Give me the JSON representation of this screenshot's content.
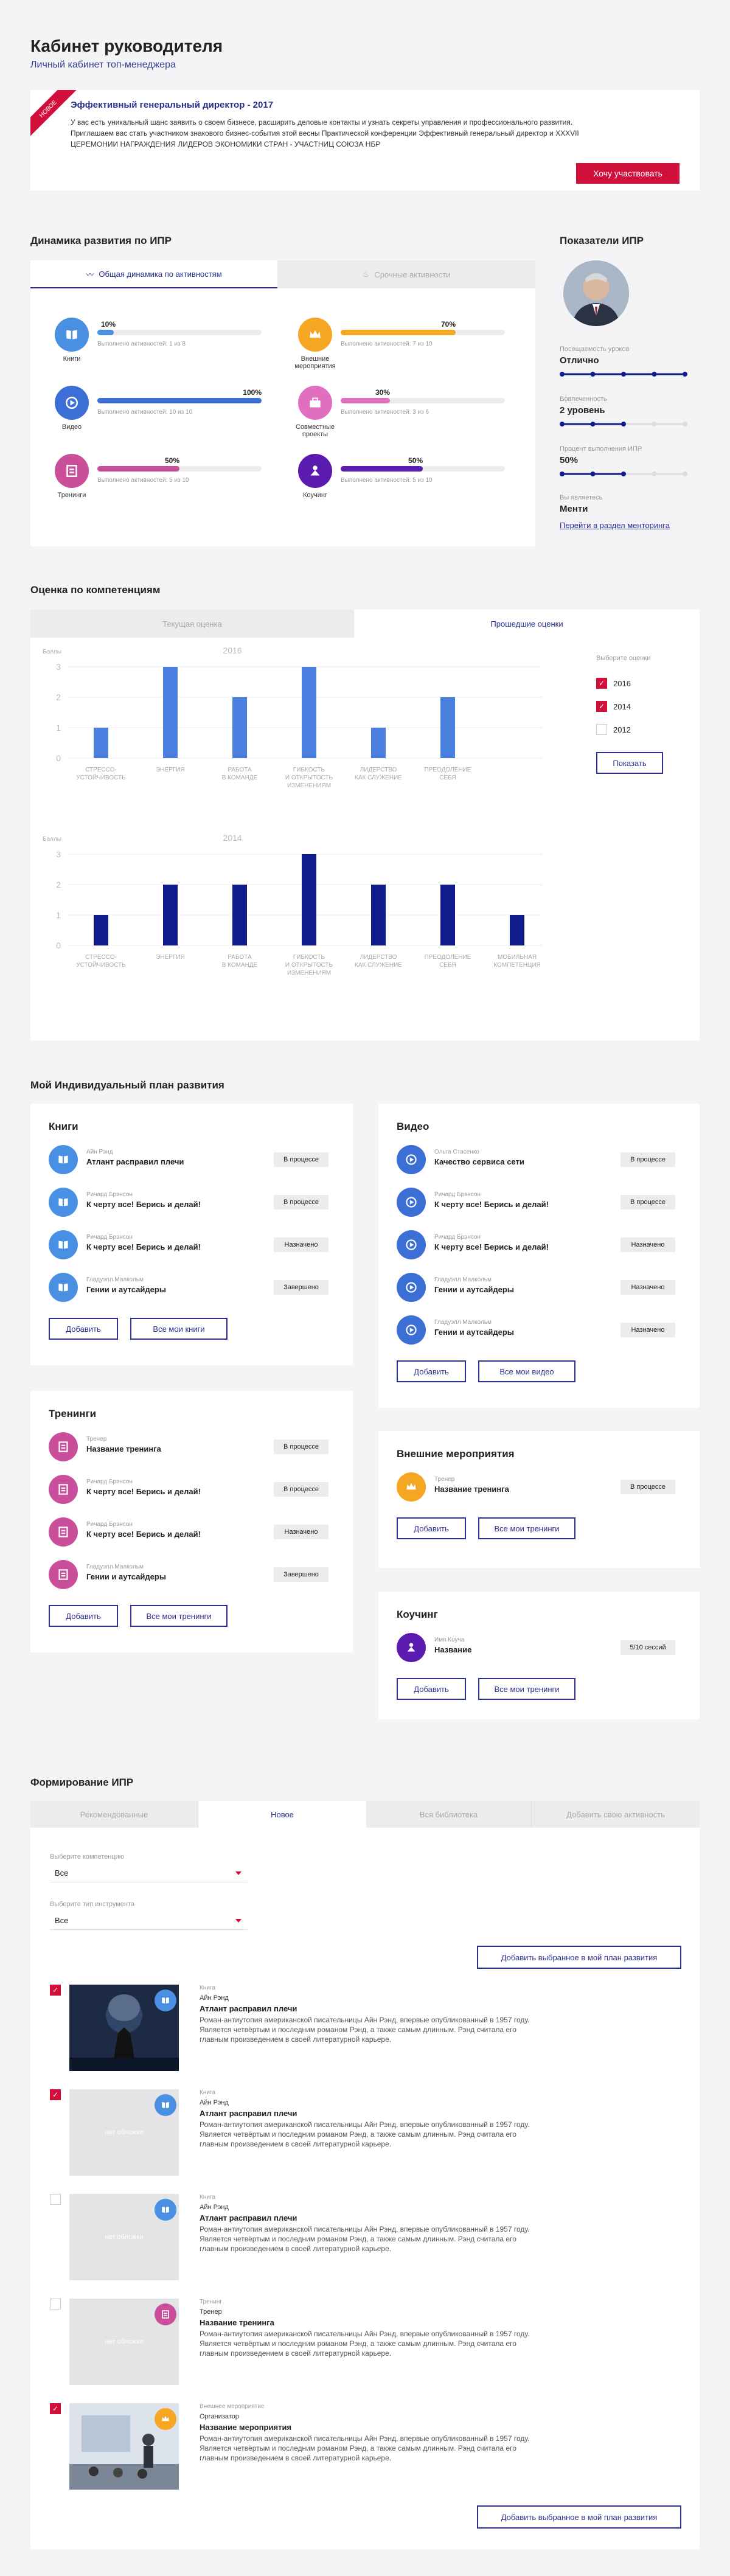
{
  "header": {
    "title": "Кабинет руководителя",
    "subtitle": "Личный кабинет топ-менеджера"
  },
  "promo": {
    "ribbon": "НОВОЕ",
    "title": "Эффективный генеральный директор - 2017",
    "text1": "У вас есть уникальный шанс заявить о своем бизнесе, расширить деловые контакты и узнать секреты управления и профессионального развития.",
    "text2": "Приглашаем вас стать участником знакового бизнес-события этой весны Практической конференции Эффективный генеральный директор и XXXVII",
    "text3": "ЦЕРЕМОНИИ НАГРАЖДЕНИЯ ЛИДЕРОВ ЭКОНОМИКИ СТРАН - УЧАСТНИЦ СОЮЗА НБР",
    "button": "Хочу участвовать"
  },
  "dynamics": {
    "title": "Динамика развития по ИПР",
    "tabs": [
      "Общая динамика по активностям",
      "Срочные активности"
    ],
    "items": [
      {
        "label": "Книги",
        "pct": "10%",
        "fill": 0.1,
        "note": "Выполнено активностей: 1 из 8",
        "color": "#4a90e2",
        "icon": "book-icon"
      },
      {
        "label": "Внешние мероприятия",
        "pct": "70%",
        "fill": 0.7,
        "note": "Выполнено активностей: 7 из 10",
        "color": "#f5a623",
        "icon": "crown-icon"
      },
      {
        "label": "Видео",
        "pct": "100%",
        "fill": 1.0,
        "note": "Выполнено активностей: 10 из 10",
        "color": "#3b6fd6",
        "icon": "play-icon"
      },
      {
        "label": "Совместные проекты",
        "pct": "30%",
        "fill": 0.3,
        "note": "Выполнено активностей: 3 из 6",
        "color": "#e06fc0",
        "icon": "briefcase-icon"
      },
      {
        "label": "Тренинги",
        "pct": "50%",
        "fill": 0.5,
        "note": "Выполнено активностей: 5 из 10",
        "color": "#c94f9a",
        "icon": "training-icon"
      },
      {
        "label": "Коучинг",
        "pct": "50%",
        "fill": 0.5,
        "note": "Выполнено активностей: 5 из 10",
        "color": "#5b1bb0",
        "icon": "coaching-icon"
      }
    ]
  },
  "ipr": {
    "title": "Показатели ИПР",
    "rows": [
      {
        "caption": "Посещаемость уроков",
        "value": "Отлично",
        "level": 1.0
      },
      {
        "caption": "Вовлеченность",
        "value": "2 уровень",
        "level": 0.5
      },
      {
        "caption": "Процент выполнения ИПР",
        "value": "50%",
        "level": 0.5
      }
    ],
    "mentor_caption": "Вы являетесь",
    "mentor_value": "Менти",
    "mentor_link": "Перейти в раздел менторинга"
  },
  "competence": {
    "title": "Оценка по компетенциям",
    "tabs": [
      "Текущая оценка",
      "Прошедшие оценки"
    ],
    "choose": "Выберите оценки",
    "years": [
      {
        "y": "2016",
        "on": true
      },
      {
        "y": "2014",
        "on": true
      },
      {
        "y": "2012",
        "on": false
      }
    ],
    "show": "Показать"
  },
  "chart_data": [
    {
      "type": "bar",
      "title": "2016",
      "ylabel": "Баллы",
      "ylim": [
        0,
        3
      ],
      "categories": [
        "СТРЕССОУСТОЙЧИВОСТЬ",
        "ЭНЕРГИЯ",
        "РАБОТА В КОМАНДЕ",
        "ГИБКОСТЬ И ОТКРЫТОСТЬ ИЗМЕНЕНИЯМ",
        "ЛИДЕРСТВО КАК СЛУЖЕНИЕ",
        "ПРЕОДОЛЕНИЕ СЕБЯ"
      ],
      "cat_lines": [
        [
          "СТРЕССО-",
          "УСТОЙЧИВОСТЬ"
        ],
        [
          "ЭНЕРГИЯ"
        ],
        [
          "РАБОТА",
          "В КОМАНДЕ"
        ],
        [
          "ГИБКОСТЬ",
          "И ОТКРЫТОСТЬ",
          "ИЗМЕНЕНИЯМ"
        ],
        [
          "ЛИДЕРСТВО",
          "КАК СЛУЖЕНИЕ"
        ],
        [
          "ПРЕОДОЛЕНИЕ",
          "СЕБЯ"
        ]
      ],
      "values": [
        1,
        3,
        2,
        3,
        1,
        2
      ],
      "color": "#4a7fe0"
    },
    {
      "type": "bar",
      "title": "2014",
      "ylabel": "Баллы",
      "ylim": [
        0,
        3
      ],
      "categories": [
        "СТРЕССОУСТОЙЧИВОСТЬ",
        "ЭНЕРГИЯ",
        "РАБОТА В КОМАНДЕ",
        "ГИБКОСТЬ И ОТКРЫТОСТЬ ИЗМЕНЕНИЯМ",
        "ЛИДЕРСТВО КАК СЛУЖЕНИЕ",
        "ПРЕОДОЛЕНИЕ СЕБЯ",
        "МОБИЛЬНАЯ КОМПЕТЕНЦИЯ"
      ],
      "cat_lines": [
        [
          "СТРЕССО-",
          "УСТОЙЧИВОСТЬ"
        ],
        [
          "ЭНЕРГИЯ"
        ],
        [
          "РАБОТА",
          "В КОМАНДЕ"
        ],
        [
          "ГИБКОСТЬ",
          "И ОТКРЫТОСТЬ",
          "ИЗМЕНЕНИЯМ"
        ],
        [
          "ЛИДЕРСТВО",
          "КАК СЛУЖЕНИЕ"
        ],
        [
          "ПРЕОДОЛЕНИЕ",
          "СЕБЯ"
        ],
        [
          "МОБИЛЬНАЯ",
          "КОМПЕТЕНЦИЯ"
        ]
      ],
      "values": [
        1,
        2,
        2,
        3,
        2,
        2,
        1
      ],
      "color": "#101c8c"
    }
  ],
  "plan": {
    "title": "Мой Индивидуальный план развития",
    "add": "Добавить",
    "books": {
      "title": "Книги",
      "all": "Все мои книги",
      "items": [
        {
          "author": "Айн Рэнд",
          "name": "Атлант расправил плечи",
          "status": "В процессе"
        },
        {
          "author": "Ричард Брэнсон",
          "name": "К черту все! Берись и делай!",
          "status": "В процессе"
        },
        {
          "author": "Ричард Брэнсон",
          "name": "К черту все! Берись и делай!",
          "status": "Назначено"
        },
        {
          "author": "Гладуэлл Малкольм",
          "name": "Гении и аутсайдеры",
          "status": "Завершено"
        }
      ]
    },
    "video": {
      "title": "Видео",
      "all": "Все мои видео",
      "items": [
        {
          "author": "Ольга Стасенко",
          "name": "Качество сервиса сети",
          "status": "В процессе"
        },
        {
          "author": "Ричард Брэнсон",
          "name": "К черту все! Берись и делай!",
          "status": "В процессе"
        },
        {
          "author": "Ричард Брэнсон",
          "name": "К черту все! Берись и делай!",
          "status": "Назначено"
        },
        {
          "author": "Гладуэлл Малкольм",
          "name": "Гении и аутсайдеры",
          "status": "Назначено"
        },
        {
          "author": "Гладуэлл Малкольм",
          "name": "Гении и аутсайдеры",
          "status": "Назначено"
        }
      ]
    },
    "trainings": {
      "title": "Тренинги",
      "all": "Все мои тренинги",
      "items": [
        {
          "author": "Тренер",
          "name": "Название тренинга",
          "status": "В процессе"
        },
        {
          "author": "Ричард Брэнсон",
          "name": "К черту все! Берись и делай!",
          "status": "В процессе"
        },
        {
          "author": "Ричард Брэнсон",
          "name": "К черту все! Берись и делай!",
          "status": "Назначено"
        },
        {
          "author": "Гладуэлл Малкольм",
          "name": "Гении и аутсайдеры",
          "status": "Завершено"
        }
      ]
    },
    "events": {
      "title": "Внешние мероприятия",
      "all": "Все мои тренинги",
      "items": [
        {
          "author": "Тренер",
          "name": "Название тренинга",
          "status": "В процессе"
        }
      ]
    },
    "coaching": {
      "title": "Коучинг",
      "all": "Все мои тренинги",
      "items": [
        {
          "author": "Имя Коуча",
          "name": "Название",
          "status": "5/10 сессий"
        }
      ]
    }
  },
  "form": {
    "title": "Формирование ИПР",
    "tabs": [
      "Рекомендованные",
      "Новое",
      "Вся библиотека",
      "Добавить свою активность"
    ],
    "comp_label": "Выберите компетенцию",
    "comp_value": "Все",
    "type_label": "Выберите тип инструмента",
    "type_value": "Все",
    "add_selected": "Добавить выбранное в мой план развития",
    "no_image": "нет обложки",
    "cards": [
      {
        "type": "Книга",
        "author": "Айн Рэнд",
        "name": "Атлант расправил плечи",
        "checked": true,
        "photo": true
      },
      {
        "type": "Книга",
        "author": "Айн Рэнд",
        "name": "Атлант расправил плечи",
        "checked": true,
        "photo": false
      },
      {
        "type": "Книга",
        "author": "Айн Рэнд",
        "name": "Атлант расправил плечи",
        "checked": false,
        "photo": false
      },
      {
        "type": "Тренинг",
        "author": "Тренер",
        "name": "Название тренинга",
        "checked": false,
        "photo": false
      },
      {
        "type": "Внешнее мероприятие",
        "author": "Организатор",
        "name": "Название мероприятия",
        "checked": true,
        "photo": true
      }
    ],
    "desc1": "Роман-антиутопия американской писательницы Айн Рэнд, впервые опубликованный в 1957 году.",
    "desc2": "Является четвёртым и последним романом Рэнд, а также самым длинным. Рэнд считала его",
    "desc3": "главным произведением в своей литературной карьере."
  },
  "colors": {
    "accent": "#d0103a",
    "navy": "#2a2e8c"
  }
}
